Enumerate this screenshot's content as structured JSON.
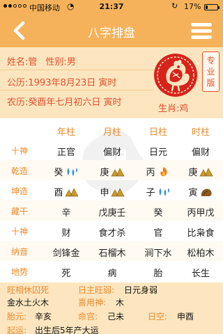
{
  "status_bar": {
    "carrier": "中国移动",
    "time": "21:37",
    "battery": "17%",
    "battery_level": 0.17
  },
  "nav": {
    "title": "八字排盘"
  },
  "profile": {
    "name": "姓名:管",
    "gender": "性别:男",
    "solar": "公历:1993年8月23日 寅时",
    "lunar": "农历:癸酉年七月初六日 寅时",
    "pro_badge": "专业版",
    "zodiac": "生肖:鸡"
  },
  "grid": {
    "columns": [
      "年柱",
      "月柱",
      "日柱",
      "时柱"
    ],
    "rows": [
      {
        "label": "十神",
        "cells": [
          "正官",
          "偏财",
          "日元",
          "偏财"
        ]
      },
      {
        "label": "乾造",
        "cells": [
          {
            "char": "癸",
            "icon": "water-icon"
          },
          {
            "char": "庚",
            "icon": "metal-icon"
          },
          {
            "char": "丙",
            "icon": "fire-icon"
          },
          {
            "char": "庚",
            "icon": "metal-icon"
          }
        ]
      },
      {
        "label": "坤造",
        "cells": [
          {
            "char": "酉",
            "icon": "metal-icon"
          },
          {
            "char": "申",
            "icon": "metal-icon"
          },
          {
            "char": "子",
            "icon": "water-icon"
          },
          {
            "char": "寅",
            "icon": "wood-icon"
          }
        ]
      },
      {
        "label": "藏干",
        "cells": [
          "辛",
          "戊庚壬",
          "癸",
          "丙甲戊"
        ]
      },
      {
        "label": "十神",
        "cells": [
          "财",
          "食才杀",
          "官",
          "比枭食"
        ]
      },
      {
        "label": "纳音",
        "cells": [
          "剑锋金",
          "石榴木",
          "涧下水",
          "松柏木"
        ]
      },
      {
        "label": "地势",
        "cells": [
          "死",
          "病",
          "胎",
          "长生"
        ]
      }
    ]
  },
  "info": {
    "wang_label": "旺相休囚死",
    "wang_value": "金水土火木",
    "rizhu_label": "日主旺弱:",
    "rizhu_value": "日元身弱",
    "xiyong_label": "喜用神:",
    "xiyong_value": "木",
    "taiyuan_label": "胎元:",
    "taiyuan_value": "辛亥",
    "minggong_label": "命宫:",
    "minggong_value": "己未",
    "rikong_label": "日空:",
    "rikong_value": "申酉",
    "qiyun_label": "起运:",
    "qiyun_value": "出生后5年产大运"
  },
  "colors": {
    "header_bg": "#f5b25a",
    "panel_bg": "#fde6bf",
    "label_orange": "#e98a2c",
    "accent_red": "#e05030"
  }
}
